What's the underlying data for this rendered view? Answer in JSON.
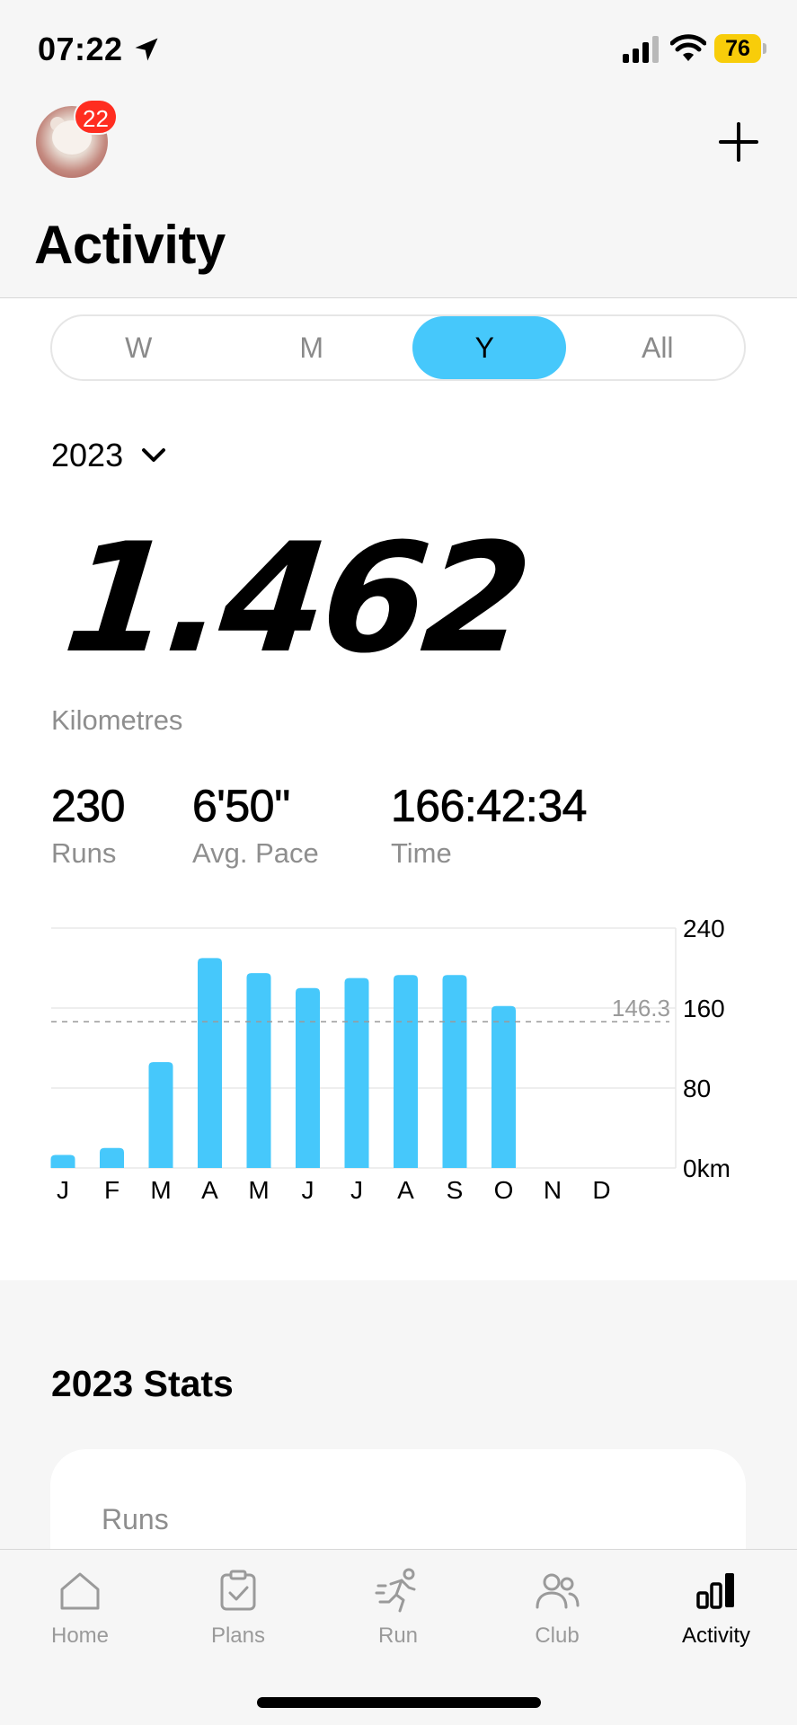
{
  "status_bar": {
    "time": "07:22",
    "battery": "76",
    "icons": [
      "location-arrow-icon",
      "signal-icon",
      "wifi-icon",
      "battery-icon"
    ]
  },
  "header": {
    "notification_count": "22",
    "title": "Activity"
  },
  "period_tabs": [
    {
      "label": "W",
      "active": false
    },
    {
      "label": "M",
      "active": false
    },
    {
      "label": "Y",
      "active": true
    },
    {
      "label": "All",
      "active": false
    }
  ],
  "year_selector": {
    "value": "2023"
  },
  "summary": {
    "distance": "1.462",
    "distance_unit": "Kilometres",
    "runs_value": "230",
    "runs_label": "Runs",
    "pace_value": "6'50''",
    "pace_label": "Avg. Pace",
    "time_value": "166:42:34",
    "time_label": "Time"
  },
  "chart_data": {
    "type": "bar",
    "categories": [
      "J",
      "F",
      "M",
      "A",
      "M",
      "J",
      "J",
      "A",
      "S",
      "O",
      "N",
      "D"
    ],
    "values": [
      13,
      20,
      106,
      210,
      195,
      180,
      190,
      193,
      193,
      162,
      0,
      0
    ],
    "y_ticks": [
      "240",
      "160",
      "80",
      "0km"
    ],
    "y_tick_values": [
      240,
      160,
      80,
      0
    ],
    "ylim": [
      0,
      240
    ],
    "average": 146.3,
    "average_label": "146.3",
    "bar_color": "#46c8fb",
    "grid": true
  },
  "stats": {
    "title": "2023 Stats",
    "card_label": "Runs"
  },
  "tabbar": {
    "items": [
      {
        "label": "Home",
        "icon": "home-icon",
        "active": false
      },
      {
        "label": "Plans",
        "icon": "clipboard-check-icon",
        "active": false
      },
      {
        "label": "Run",
        "icon": "runner-icon",
        "active": false
      },
      {
        "label": "Club",
        "icon": "people-icon",
        "active": false
      },
      {
        "label": "Activity",
        "icon": "bar-chart-icon",
        "active": true
      }
    ]
  },
  "colors": {
    "accent": "#46c8fb",
    "badge": "#ff2d20",
    "battery": "#f8cd0a",
    "muted_text": "#8e8e8e"
  }
}
